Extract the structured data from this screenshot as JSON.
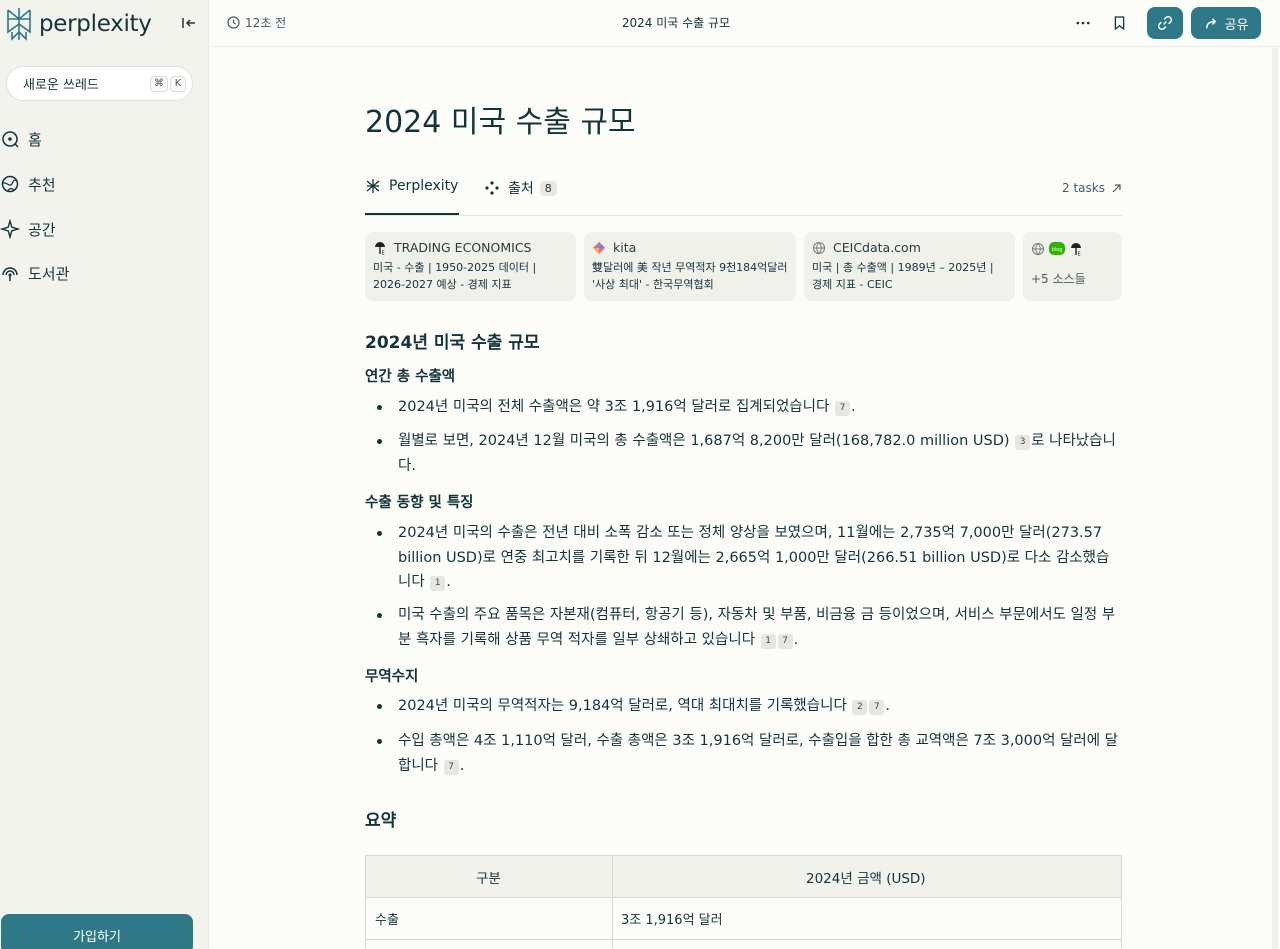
{
  "sidebar": {
    "brand": "perplexity",
    "new_thread": "새로운 쓰레드",
    "shortcut_cmd": "⌘",
    "shortcut_key": "K",
    "nav": [
      "홈",
      "추천",
      "공간",
      "도서관"
    ],
    "signup": "가입하기"
  },
  "topbar": {
    "time": "12초 전",
    "title": "2024 미국 수출 규모",
    "share": "공유"
  },
  "main": {
    "title": "2024 미국 수출 규모",
    "tabs": {
      "perplexity": "Perplexity",
      "sources": "출처",
      "sources_count": "8",
      "tasks": "2 tasks"
    },
    "sources": [
      {
        "site": "TRADING ECONOMICS",
        "text": "미국 - 수출 | 1950-2025 데이터 | 2026-2027 예상 - 경제 지표"
      },
      {
        "site": "kita",
        "text": "雙달러에 美 작년 무역적자 9천184억달러 '사상 최대' - 한국무역협회"
      },
      {
        "site": "CEICdata.com",
        "text": "미국 | 총 수출액 | 1989년 – 2025년 | 경제 지표 - CEIC"
      },
      {
        "more": "+5 소스들",
        "badge": "blog"
      }
    ],
    "section_title": "2024년 미국 수출 규모",
    "sub1": "연간 총 수출액",
    "b1": "2024년 미국의 전체 수출액은 약 3조 1,916억 달러로 집계되었습니다",
    "b1_cite": "7",
    "b2": "월별로 보면, 2024년 12월 미국의 총 수출액은 1,687억 8,200만 달러(168,782.0 million USD)",
    "b2_cite": "3",
    "b2_tail": "로 나타났습니다.",
    "sub2": "수출 동향 및 특징",
    "b3": "2024년 미국의 수출은 전년 대비 소폭 감소 또는 정체 양상을 보였으며, 11월에는 2,735억 7,000만 달러(273.57 billion USD)로 연중 최고치를 기록한 뒤 12월에는 2,665억 1,000만 달러(266.51 billion USD)로 다소 감소했습니다",
    "b3_cite": "1",
    "b4": "미국 수출의 주요 품목은 자본재(컴퓨터, 항공기 등), 자동차 및 부품, 비금융 금 등이었으며, 서비스 부문에서도 일정 부분 흑자를 기록해 상품 무역 적자를 일부 상쇄하고 있습니다",
    "b4_cite1": "1",
    "b4_cite2": "7",
    "sub3": "무역수지",
    "b5": "2024년 미국의 무역적자는 9,184억 달러로, 역대 최대치를 기록했습니다",
    "b5_cite1": "2",
    "b5_cite2": "7",
    "b6": "수입 총액은 4조 1,110억 달러, 수출 총액은 3조 1,916억 달러로, 수출입을 합한 총 교역액은 7조 3,000억 달러에 달합니다",
    "b6_cite": "7",
    "summary": "요약",
    "table": {
      "headers": [
        "구분",
        "2024년 금액 (USD)"
      ],
      "rows": [
        [
          "수출",
          "3조 1,916억 달러"
        ]
      ]
    }
  }
}
